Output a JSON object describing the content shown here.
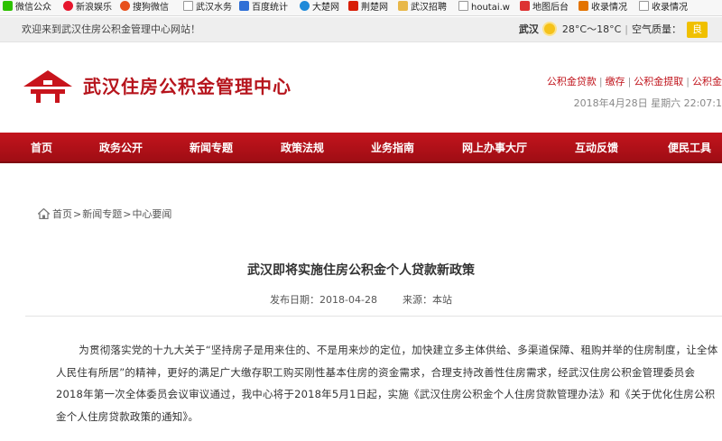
{
  "bookmarks": [
    {
      "label": "微信公众",
      "icon": "wechat-icon",
      "color": "#2dc100"
    },
    {
      "label": "新浪娱乐",
      "icon": "sina-icon",
      "color": "#e6162d"
    },
    {
      "label": "搜狗微信",
      "icon": "sogou-icon",
      "color": "#e7501c"
    },
    {
      "label": "武汉水务",
      "icon": "page-icon",
      "color": ""
    },
    {
      "label": "百度统计",
      "icon": "baidu-stats-icon",
      "color": "#2f6fd6"
    },
    {
      "label": "大楚网",
      "icon": "dachu-icon",
      "color": "#1e8ad9"
    },
    {
      "label": "荆楚网",
      "icon": "jingchu-icon",
      "color": "#d81e06"
    },
    {
      "label": "武汉招聘",
      "icon": "folder-icon",
      "color": "#e8b84a"
    },
    {
      "label": "houtai.w",
      "icon": "page-icon",
      "color": ""
    },
    {
      "label": "地图后台",
      "icon": "map-icon",
      "color": "#d33"
    },
    {
      "label": "收录情况",
      "icon": "chart-icon",
      "color": "#e37300"
    },
    {
      "label": "收录情况",
      "icon": "page-icon",
      "color": ""
    }
  ],
  "topbar": {
    "welcome": "欢迎来到武汉住房公积金管理中心网站！",
    "city": "武汉",
    "temp": "28°C～18°C",
    "air_label": "空气质量：",
    "air_value": "良"
  },
  "header": {
    "title": "武汉住房公积金管理中心",
    "links": [
      "公积金贷款",
      "缴存",
      "公积金提取",
      "公积金"
    ],
    "date": "2018年4月28日 星期六 22:07:1"
  },
  "nav": [
    "首页",
    "政务公开",
    "新闻专题",
    "政策法规",
    "业务指南",
    "网上办事大厅",
    "互动反馈",
    "便民工具"
  ],
  "breadcrumb": {
    "items": [
      "首页",
      "新闻专题",
      "中心要闻"
    ],
    "sep": ">"
  },
  "article": {
    "title": "武汉即将实施住房公积金个人贷款新政策",
    "date": "发布日期：2018-04-28",
    "source": "来源：本站",
    "body": "为贯彻落实党的十九大关于“坚持房子是用来住的、不是用来炒的定位，加快建立多主体供给、多渠道保障、租购并举的住房制度，让全体人民住有所居”的精神，更好的满足广大缴存职工购买刚性基本住房的资金需求，合理支持改善性住房需求，经武汉住房公积金管理委员会2018年第一次全体委员会议审议通过，我中心将于2018年5月1日起，实施《武汉住房公积金个人住房贷款管理办法》和《关于优化住房公积金个人住房贷款政策的通知》。"
  },
  "colors": {
    "brand": "#b6141c",
    "nav": "#b3111a",
    "aqi": "#f0c000"
  }
}
